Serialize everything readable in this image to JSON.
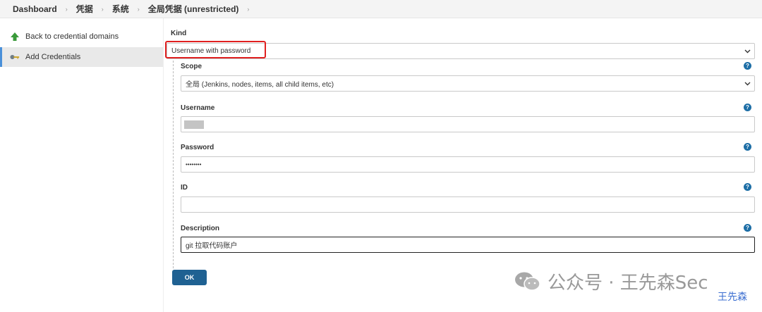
{
  "breadcrumb": {
    "items": [
      "Dashboard",
      "凭据",
      "系统",
      "全局凭据 (unrestricted)"
    ]
  },
  "sidebar": {
    "items": [
      {
        "label": "Back to credential domains",
        "icon": "arrow-up-icon"
      },
      {
        "label": "Add Credentials",
        "icon": "key-icon"
      }
    ]
  },
  "form": {
    "kind": {
      "label": "Kind",
      "value": "Username with password"
    },
    "scope": {
      "label": "Scope",
      "value": "全局 (Jenkins, nodes, items, all child items, etc)"
    },
    "username": {
      "label": "Username",
      "value": ""
    },
    "password": {
      "label": "Password",
      "value": "••••••••"
    },
    "id": {
      "label": "ID",
      "value": ""
    },
    "description": {
      "label": "Description",
      "value": "git 拉取代码账户"
    },
    "help_glyph": "?",
    "ok_label": "OK"
  },
  "watermark": {
    "text": "公众号 · 王先森Sec",
    "small": "王先森"
  },
  "colors": {
    "accent": "#1f6192",
    "help": "#1d6ea6",
    "highlight": "#e02020",
    "active_border": "#4a90d9"
  }
}
